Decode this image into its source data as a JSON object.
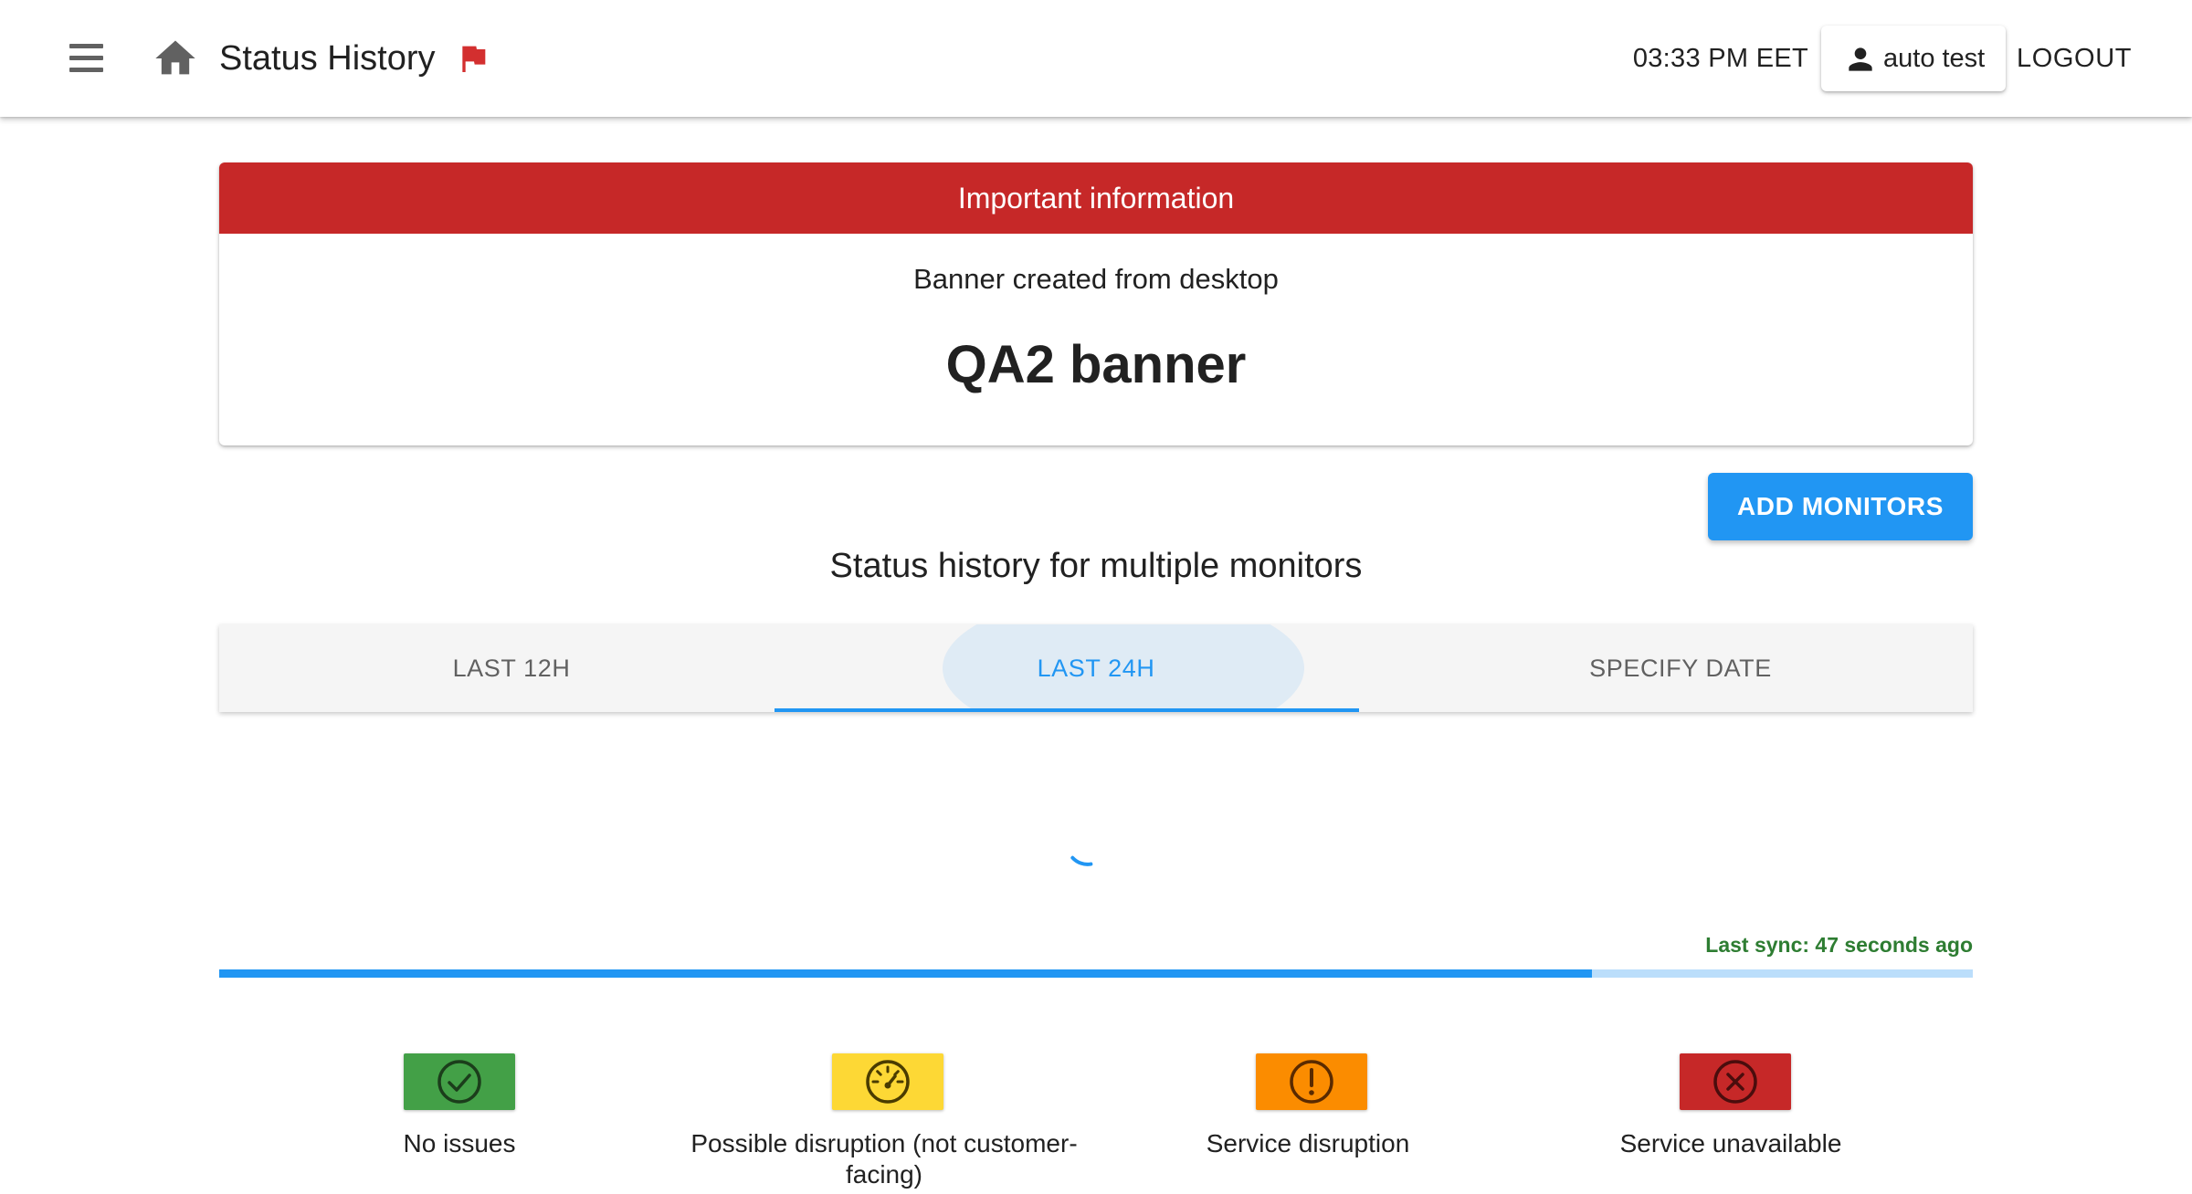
{
  "header": {
    "title": "Status History",
    "time": "03:33 PM EET",
    "user": "auto test",
    "logout_label": "LOGOUT"
  },
  "banner": {
    "heading": "Important information",
    "subtitle": "Banner created from desktop",
    "title": "QA2 banner"
  },
  "main": {
    "add_monitors_label": "ADD MONITORS",
    "section_title": "Status history for multiple monitors",
    "tabs": [
      {
        "label": "LAST 12H",
        "active": false
      },
      {
        "label": "LAST 24H",
        "active": true
      },
      {
        "label": "SPECIFY DATE",
        "active": false
      }
    ],
    "last_sync": "Last sync: 47 seconds ago",
    "sync_progress": 0.783
  },
  "legend": [
    {
      "label": "No issues",
      "color": "#43a047",
      "icon": "check-circle-icon"
    },
    {
      "label": "Possible disruption (not customer-facing)",
      "color": "#fdd835",
      "icon": "speedometer-icon"
    },
    {
      "label": "Service disruption",
      "color": "#fb8c00",
      "icon": "exclamation-circle-icon"
    },
    {
      "label": "Service unavailable",
      "color": "#c62828",
      "icon": "x-circle-icon"
    }
  ],
  "colors": {
    "accent": "#2196f3",
    "banner_red": "#c62828",
    "flag": "#d32f2f",
    "sync_green": "#2e7d32"
  }
}
